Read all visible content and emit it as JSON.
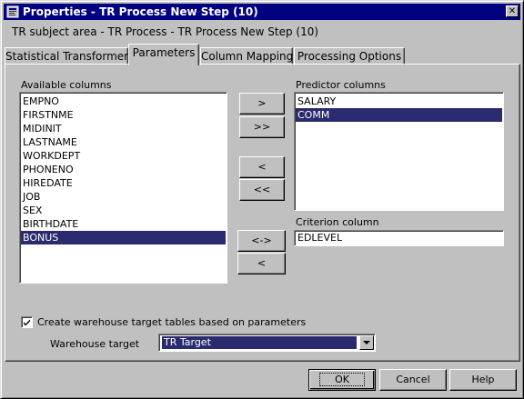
{
  "window": {
    "title": "Properties - TR Process New Step (10)",
    "close_glyph": "✕"
  },
  "subject_area": "TR subject area - TR Process - TR Process New Step (10)",
  "tabs": [
    {
      "label": "Statistical Transformer",
      "active": false
    },
    {
      "label": "Parameters",
      "active": true
    },
    {
      "label": "Column Mapping",
      "active": false
    },
    {
      "label": "Processing Options",
      "active": false
    }
  ],
  "available": {
    "label": "Available columns",
    "items": [
      "EMPNO",
      "FIRSTNME",
      "MIDINIT",
      "LASTNAME",
      "WORKDEPT",
      "PHONENO",
      "HIREDATE",
      "JOB",
      "SEX",
      "BIRTHDATE",
      "BONUS"
    ],
    "selected": "BONUS"
  },
  "predictor": {
    "label": "Predictor columns",
    "items": [
      "SALARY",
      "COMM"
    ],
    "selected": "COMM"
  },
  "criterion": {
    "label": "Criterion column",
    "value": "EDLEVEL"
  },
  "move_buttons": {
    "add": ">",
    "add_all": ">>",
    "remove": "<",
    "remove_all": "<<",
    "swap": "<->",
    "remove_criterion": "<"
  },
  "options": {
    "create_tables_label": "Create warehouse target tables based on parameters",
    "create_tables_checked": true,
    "warehouse_target_label": "Warehouse target",
    "warehouse_target_value": "TR Target"
  },
  "footer": {
    "ok": "OK",
    "cancel": "Cancel",
    "help": "Help"
  },
  "colors": {
    "titlebar": "#000080",
    "selection": "#2a2a6e",
    "face": "#c0c0c0"
  }
}
